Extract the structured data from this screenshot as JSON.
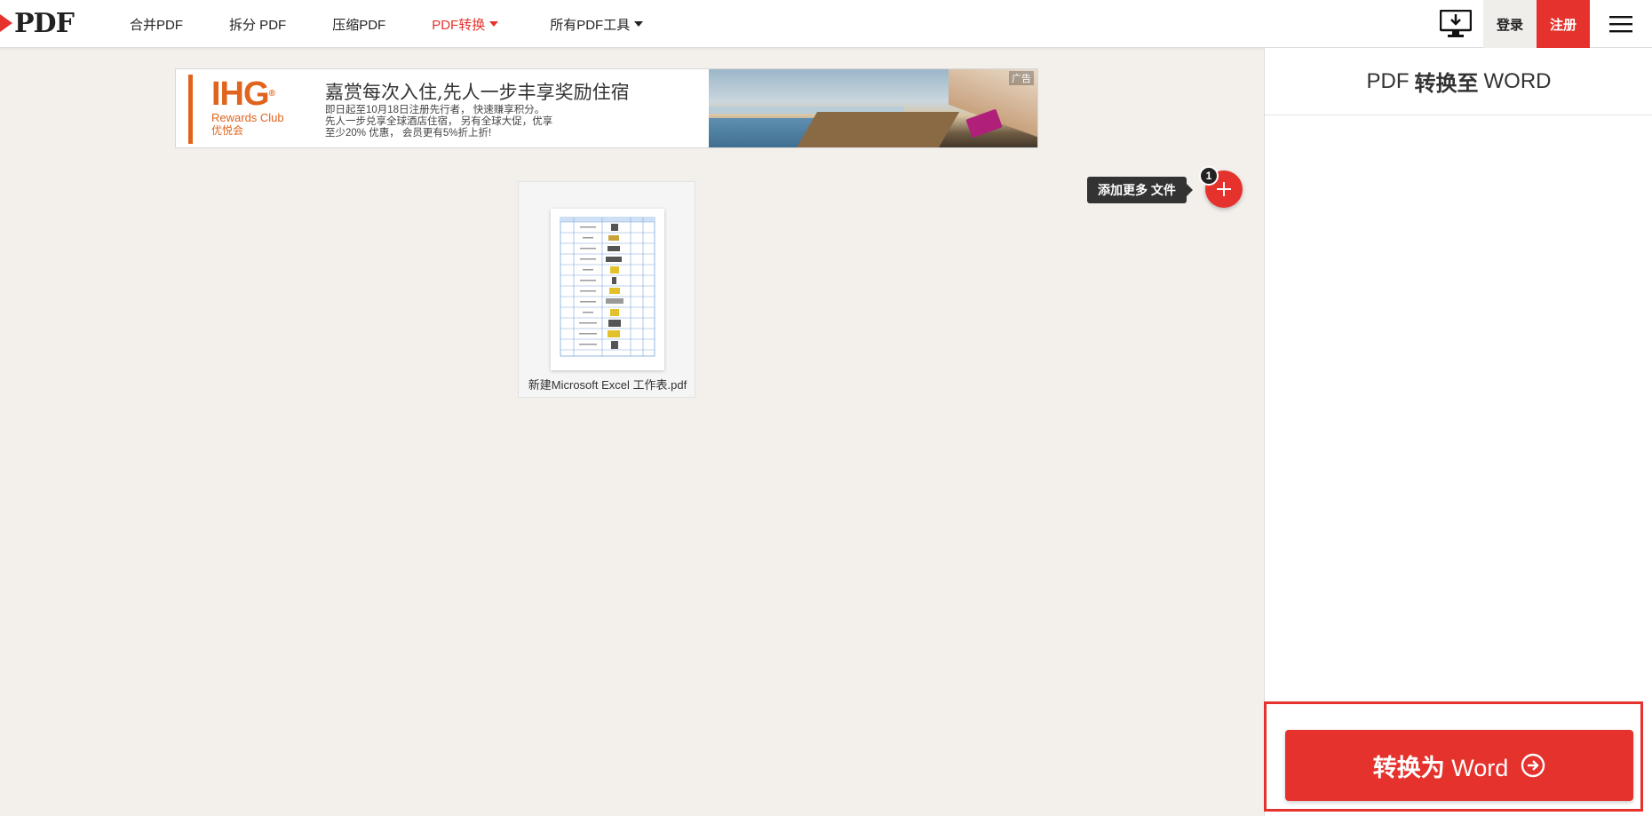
{
  "header": {
    "logo_text": "PDF",
    "nav": [
      {
        "label": "合并PDF"
      },
      {
        "label": "拆分 PDF"
      },
      {
        "label": "压缩PDF"
      },
      {
        "label": "PDF转换"
      },
      {
        "label": "所有PDF工具"
      }
    ],
    "login_label": "登录",
    "signup_label": "注册"
  },
  "ad": {
    "brand": "IHG",
    "brand_sub": "Rewards Club",
    "brand_sub_cn": "优悦会",
    "headline": "嘉赏每次入住,先人一步丰享奖励住宿",
    "body_line1": "即日起至10月18日注册先行者， 快速赚享积分。",
    "body_line2": "先人一步兑享全球酒店住宿， 另有全球大促，优享",
    "body_line3": "至少20% 优惠， 会员更有5%折上折!",
    "label": "广告"
  },
  "upload": {
    "add_more_label": "添加更多 文件",
    "file_count": "1",
    "file_name": "新建Microsoft Excel 工作表.pdf"
  },
  "sidebar": {
    "title_pre": "PDF",
    "title_mid": "转换至",
    "title_post": "WORD",
    "convert_label_cn": "转换为",
    "convert_label_en": "Word"
  },
  "colors": {
    "accent": "#e5322d",
    "dark": "#333333",
    "ad_orange": "#e0641d",
    "page_bg": "#f3f0ec"
  }
}
